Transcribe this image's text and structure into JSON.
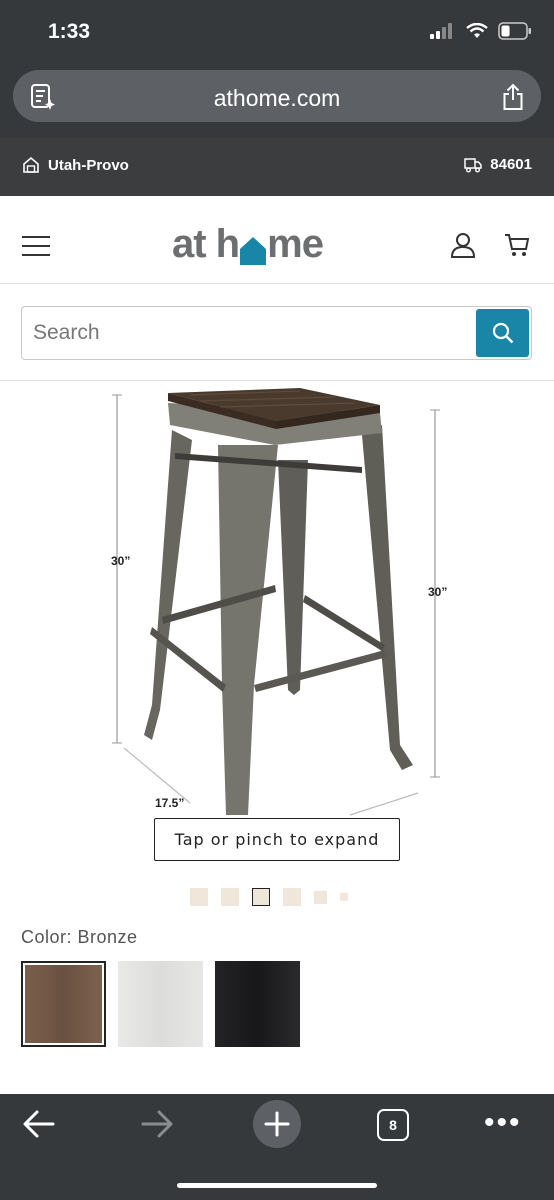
{
  "status": {
    "time": "1:33",
    "battery_level": 0.35
  },
  "browser": {
    "url": "athome.com"
  },
  "location": {
    "store": "Utah-Provo",
    "zip": "84601"
  },
  "header": {
    "logo_left": "at h",
    "logo_right": "me",
    "brand_color": "#1985a7"
  },
  "search": {
    "placeholder": "Search"
  },
  "product": {
    "dimensions": {
      "left_height": "30”",
      "right_height": "30”",
      "depth": "17.5”"
    },
    "expand_label": "Tap or pinch to expand",
    "image_count": 6,
    "selected_image_index": 2
  },
  "color": {
    "label": "Color: Bronze",
    "swatches": [
      {
        "name": "Bronze",
        "color": "#6e5444",
        "selected": true
      },
      {
        "name": "White",
        "color": "#e4e4e2",
        "selected": false
      },
      {
        "name": "Black",
        "color": "#1d1d1f",
        "selected": false
      }
    ]
  },
  "toolbar": {
    "tab_count": "8"
  }
}
